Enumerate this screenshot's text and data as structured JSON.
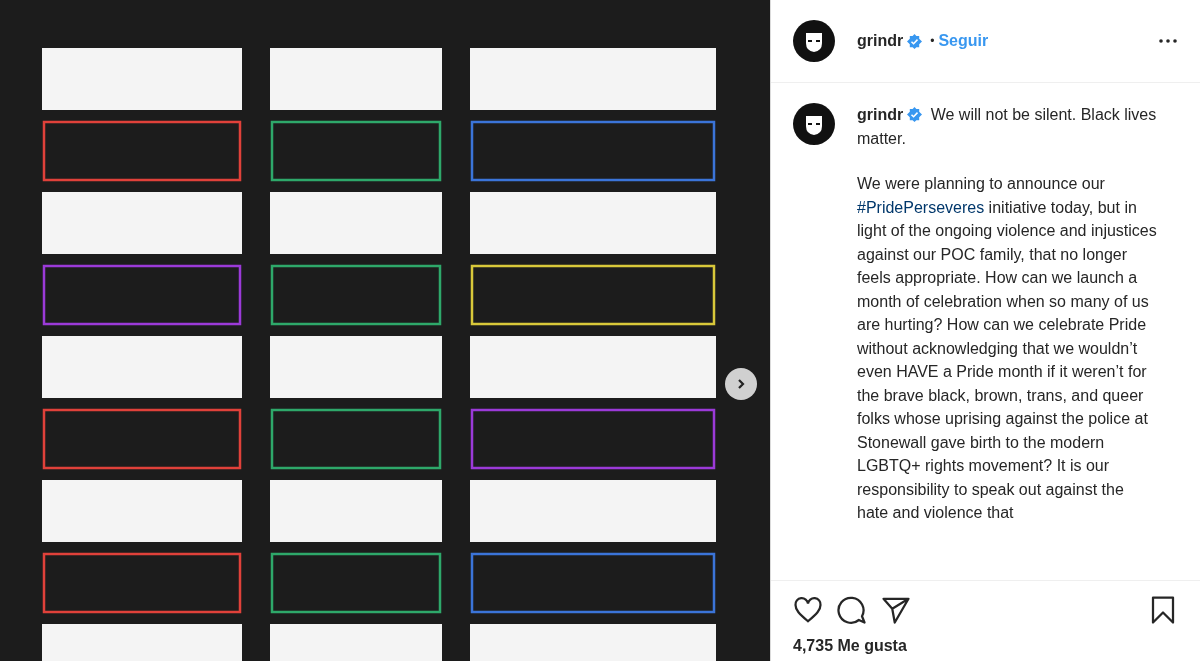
{
  "header": {
    "username": "grindr",
    "verified": true,
    "separator": "•",
    "follow": "Seguir"
  },
  "caption": {
    "username": "grindr",
    "verified": true,
    "intro": "We will not be silent. Black lives matter.",
    "body": [
      {
        "kind": "text",
        "text": "We were planning to announce our "
      },
      {
        "kind": "hashtag",
        "text": "#PridePerseveres"
      },
      {
        "kind": "text",
        "text": " initiative today, but in light of the ongoing violence and injustices against our POC family, that no longer feels appropriate. How can we launch a month of celebration when so many of us are hurting? How can we celebrate Pride without acknowledging that we wouldn’t even HAVE a Pride month if it weren’t for the brave black, brown, trans, and queer folks whose uprising against the police at Stonewall gave birth to the modern LGBTQ+ rights movement? It is our responsibility to speak out against the hate and violence that"
      }
    ]
  },
  "likes": "4,735 Me gusta"
}
